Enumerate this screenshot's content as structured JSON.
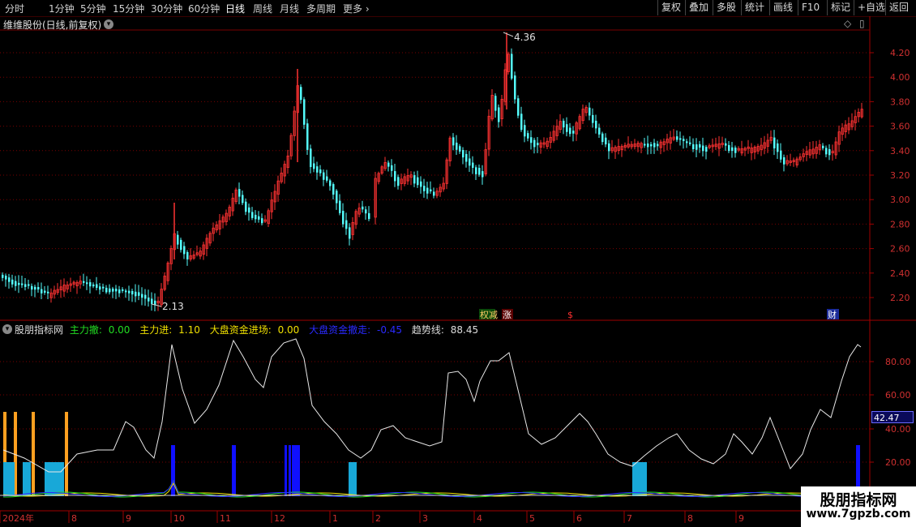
{
  "toolbar": {
    "periods": [
      "分时",
      "1分钟",
      "5分钟",
      "15分钟",
      "30分钟",
      "60分钟",
      "日线",
      "周线",
      "月线",
      "多周期",
      "更多"
    ],
    "active_period": "日线",
    "buttons": [
      "复权",
      "叠加",
      "多股",
      "统计",
      "画线",
      "F10",
      "标记",
      "+自选",
      "返回"
    ]
  },
  "stock": {
    "title": "维维股份(日线,前复权)",
    "max_label": "4.36",
    "min_label": "2.13"
  },
  "price_axis": {
    "ticks": [
      "4.20",
      "4.00",
      "3.80",
      "3.60",
      "3.40",
      "3.20",
      "3.00",
      "2.80",
      "2.60",
      "2.40",
      "2.20"
    ]
  },
  "event_markers": [
    "权减",
    "涨",
    "$",
    "财"
  ],
  "indicator": {
    "name": "股朋指标网",
    "items": [
      {
        "label": "主力撤:",
        "value": "0.00",
        "color": "#22dd22"
      },
      {
        "label": "主力进:",
        "value": "1.10",
        "color": "#f0e000"
      },
      {
        "label": "大盘资金进场:",
        "value": "0.00",
        "color": "#f0e000"
      },
      {
        "label": "大盘资金撤走:",
        "value": "-0.45",
        "color": "#2a2aff"
      },
      {
        "label": "趋势线:",
        "value": "88.45",
        "color": "#dddddd"
      }
    ],
    "axis_ticks": [
      "80.00",
      "60.00",
      "40.00",
      "20.00"
    ],
    "current_value": "42.47"
  },
  "time_axis": {
    "labels": [
      "2024年",
      "8",
      "9",
      "10",
      "11",
      "12",
      "1",
      "2",
      "3",
      "4",
      "5",
      "6",
      "7",
      "8",
      "9"
    ]
  },
  "watermark": {
    "line1": "股朋指标网",
    "line2": "www.7gpzb.com"
  },
  "colors": {
    "up": "#ff3232",
    "down": "#54fcfc",
    "trend": "#e8e8e8",
    "orange": "#ffa020",
    "cyan_bar": "#18a8d8",
    "blue_bar": "#1010ff",
    "grid": "#7a0000"
  }
}
